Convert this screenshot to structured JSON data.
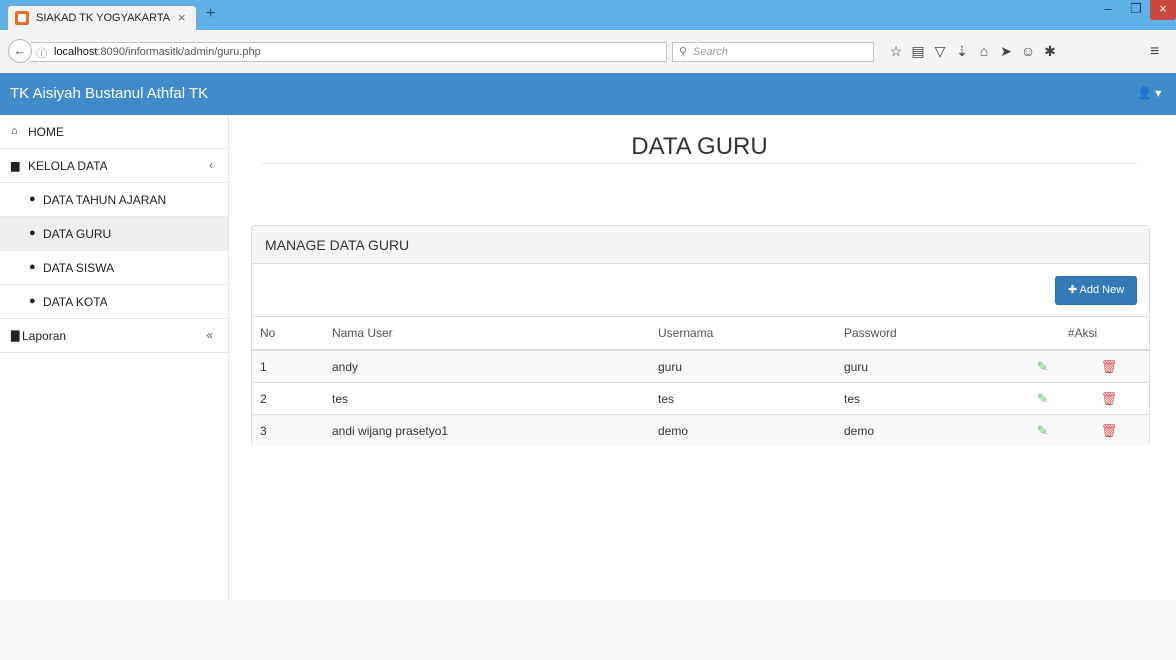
{
  "browser": {
    "tab_title": "SIAKAD TK YOGYAKARTA",
    "tab_close": "×",
    "new_tab": "+",
    "win_min": "–",
    "win_max": "❐",
    "win_close": "×",
    "url_host": "localhost",
    "url_rest": ":8090/informasitk/admin/guru.php",
    "search_placeholder": "Search",
    "toolbar_icons": [
      "star-icon",
      "reading-list-icon",
      "pocket-icon",
      "download-icon",
      "home-icon",
      "send-icon",
      "emoji-icon",
      "extension-icon"
    ]
  },
  "app": {
    "brand": "TK Aisiyah Bustanul Athfal TK",
    "user_icon": "user-icon"
  },
  "sidebar": {
    "items": [
      {
        "label": "HOME",
        "icon": "home-icon"
      },
      {
        "label": "KELOLA DATA",
        "icon": "folder-icon",
        "arrow": "‹"
      },
      {
        "label": "DATA TAHUN AJARAN",
        "icon": "user-icon"
      },
      {
        "label": "DATA GURU",
        "icon": "user-icon"
      },
      {
        "label": "DATA SISWA",
        "icon": "user-icon"
      },
      {
        "label": "DATA KOTA",
        "icon": "user-icon"
      },
      {
        "label": "Laporan",
        "icon": "file-icon",
        "arrow": "«"
      }
    ]
  },
  "main": {
    "page_title": "DATA GURU",
    "panel_title": "MANAGE DATA GURU",
    "add_button": "Add New",
    "table": {
      "headers": [
        "No",
        "Nama User",
        "Usernama",
        "Password",
        "#Aksi"
      ],
      "rows": [
        {
          "no": "1",
          "nama": "andy",
          "username": "guru",
          "password": "guru"
        },
        {
          "no": "2",
          "nama": "tes",
          "username": "tes",
          "password": "tes"
        },
        {
          "no": "3",
          "nama": "andi wijang prasetyo1",
          "username": "demo",
          "password": "demo"
        }
      ]
    }
  },
  "colors": {
    "appbar": "#428bca",
    "button": "#337ab7",
    "edit": "#5cb85c",
    "delete": "#d9534f"
  }
}
